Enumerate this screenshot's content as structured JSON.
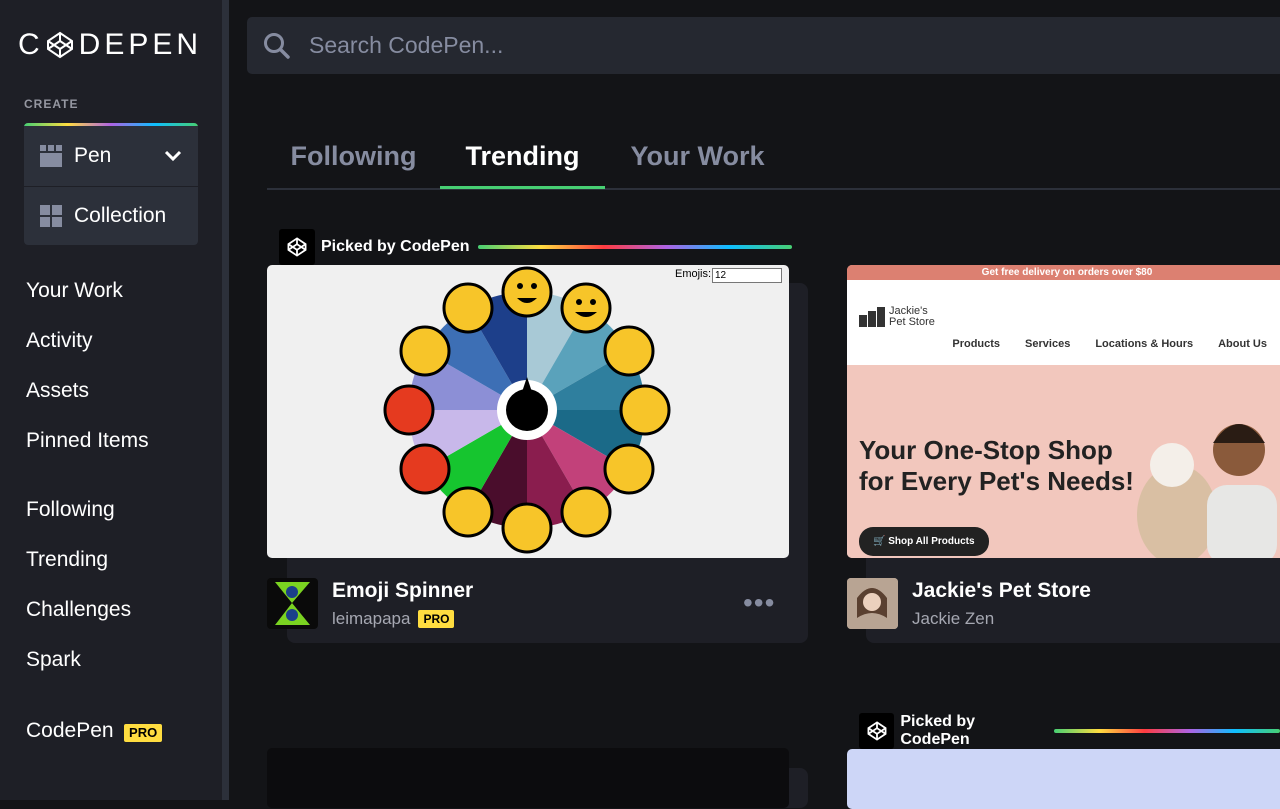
{
  "sidebar": {
    "logo_text_left": "C",
    "logo_text_right": "DEPEN",
    "create_label": "CREATE",
    "create_items": [
      {
        "label": "Pen",
        "icon": "grid-icon"
      },
      {
        "label": "Collection",
        "icon": "grid-icon"
      }
    ],
    "nav_primary": [
      "Your Work",
      "Activity",
      "Assets",
      "Pinned Items"
    ],
    "nav_secondary": [
      "Following",
      "Trending",
      "Challenges",
      "Spark"
    ],
    "codepen_pro": {
      "label": "CodePen",
      "badge": "PRO"
    }
  },
  "search": {
    "placeholder": "Search CodePen..."
  },
  "tabs": [
    {
      "label": "Following",
      "active": false
    },
    {
      "label": "Trending",
      "active": true
    },
    {
      "label": "Your Work",
      "active": false
    }
  ],
  "cards": [
    {
      "picked_label": "Picked by CodePen",
      "title": "Emoji Spinner",
      "author": "leimapapa",
      "author_badge": "PRO",
      "preview": {
        "emojis_label": "Emojis:",
        "emojis_value": "12"
      },
      "more": "•••"
    },
    {
      "title": "Jackie's Pet Store",
      "author": "Jackie Zen",
      "preview": {
        "banner": "Get free delivery on orders over $80",
        "brand_line1": "Jackie's",
        "brand_line2": "Pet Store",
        "nav": [
          "Products",
          "Services",
          "Locations & Hours",
          "About Us"
        ],
        "headline_line1": "Your One-Stop Shop",
        "headline_line2": "for Every Pet's Needs!",
        "button": "Shop All Products"
      }
    },
    {
      "picked_label": "Picked by CodePen"
    }
  ],
  "colors": {
    "accent_green": "#47cf73",
    "pro_yellow": "#ffdd40",
    "bg": "#131417",
    "sidebar_bg": "#1e1f26"
  }
}
